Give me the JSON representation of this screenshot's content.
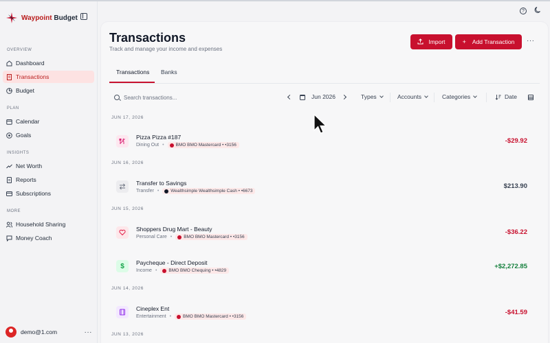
{
  "app": {
    "name_part1": "Waypoint",
    "name_part2": "Budget",
    "accent": "#c8102e"
  },
  "sidebar": {
    "sections": [
      {
        "label": "OVERVIEW"
      },
      {
        "label": "PLAN"
      },
      {
        "label": "INSIGHTS"
      },
      {
        "label": "MORE"
      }
    ],
    "items": [
      {
        "label": "Dashboard",
        "icon": "home-icon"
      },
      {
        "label": "Transactions",
        "icon": "receipt-icon",
        "active": true
      },
      {
        "label": "Budget",
        "icon": "pie-icon"
      },
      {
        "label": "Calendar",
        "icon": "calendar-icon"
      },
      {
        "label": "Goals",
        "icon": "target-icon"
      },
      {
        "label": "Net Worth",
        "icon": "trend-icon"
      },
      {
        "label": "Reports",
        "icon": "report-icon"
      },
      {
        "label": "Subscriptions",
        "icon": "card-icon"
      },
      {
        "label": "Household Sharing",
        "icon": "users-icon"
      },
      {
        "label": "Money Coach",
        "icon": "chat-icon"
      }
    ],
    "user": {
      "email": "demo@1.com",
      "more": "···"
    }
  },
  "header": {
    "title": "Transactions",
    "subtitle": "Track and manage your income and expenses",
    "import_label": "Import",
    "add_label": "Add Transaction",
    "more": "···"
  },
  "tabs": [
    {
      "label": "Transactions",
      "active": true
    },
    {
      "label": "Banks"
    }
  ],
  "filters": {
    "search_placeholder": "Search transactions...",
    "month": "Jun 2026",
    "types": "Types",
    "accounts": "Accounts",
    "categories": "Categories",
    "sort": "Date"
  },
  "groups": [
    {
      "date": "JUN 17, 2026",
      "transactions": [
        {
          "name": "Pizza Pizza #187",
          "category": "Dining Out",
          "account": "BMO BMO Mastercard • •3156",
          "amount": "-$29.92",
          "kind": "neg",
          "icon": "utensils-icon",
          "icon_color": "#db2777",
          "icon_bg": "#fde7ef"
        }
      ]
    },
    {
      "date": "JUN 16, 2026",
      "transactions": [
        {
          "name": "Transfer to Savings",
          "category": "Transfer",
          "account": "Wealthsimple Wealthsimple Cash • •6673",
          "amount": "$213.90",
          "kind": "neutral",
          "icon": "transfer-icon",
          "icon_color": "#6b7280",
          "icon_bg": "#ececef"
        }
      ]
    },
    {
      "date": "JUN 15, 2026",
      "transactions": [
        {
          "name": "Shoppers Drug Mart - Beauty",
          "category": "Personal Care",
          "account": "BMO BMO Mastercard • •3156",
          "amount": "-$36.22",
          "kind": "neg",
          "icon": "heart-icon",
          "icon_color": "#e11d48",
          "icon_bg": "#fde7ea"
        },
        {
          "name": "Paycheque - Direct Deposit",
          "category": "Income",
          "account": "BMO BMO Chequing • •4829",
          "amount": "+$2,272.85",
          "kind": "pos",
          "icon": "dollar-icon",
          "icon_color": "#16a34a",
          "icon_bg": "#dcfce7"
        }
      ]
    },
    {
      "date": "JUN 14, 2026",
      "transactions": [
        {
          "name": "Cineplex Ent",
          "category": "Entertainment",
          "account": "BMO BMO Mastercard • •3156",
          "amount": "-$41.59",
          "kind": "neg",
          "icon": "film-icon",
          "icon_color": "#9333ea",
          "icon_bg": "#f3e8ff"
        }
      ]
    },
    {
      "date": "JUN 13, 2026",
      "transactions": []
    }
  ]
}
